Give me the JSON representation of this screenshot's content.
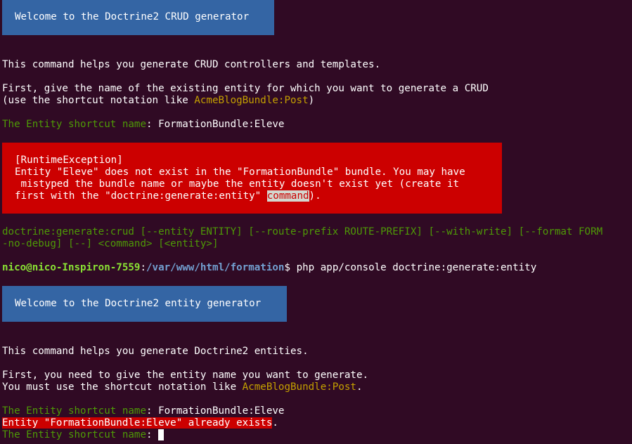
{
  "terminal": {
    "background": "#300a24",
    "colors": {
      "green": "#4e9a06",
      "yellow": "#c4a000",
      "info_box": "#3465a4",
      "error_box": "#cc0000",
      "prompt_user": "#8ae234",
      "prompt_path": "#729fcf"
    },
    "crud_banner": "Welcome to the Doctrine2 CRUD generator",
    "crud_intro": "This command helps you generate CRUD controllers and templates.",
    "crud_first_line1": "First, give the name of the existing entity for which you want to generate a CRUD",
    "crud_first_line2_prefix": "(use the shortcut notation like ",
    "crud_first_line2_example": "AcmeBlogBundle:Post",
    "crud_first_line2_suffix": ")",
    "question_label": "The Entity shortcut name",
    "question_sep": ": ",
    "answer_1": "FormationBundle:Eleve",
    "exception_title": "[RuntimeException]",
    "exception_line1": "Entity \"Eleve\" does not exist in the \"FormationBundle\" bundle. You may have",
    "exception_line2": " mistyped the bundle name or maybe the entity doesn't exist yet (create it",
    "exception_line3_prefix": "first with the \"doctrine:generate:entity\" ",
    "exception_line3_highlight": "command",
    "exception_line3_suffix": ").",
    "usage_line1": "doctrine:generate:crud [--entity ENTITY] [--route-prefix ROUTE-PREFIX] [--with-write] [--format FORM",
    "usage_line2": "-no-debug] [--] <command> [<entity>]",
    "prompt_user_host": "nico@nico-Inspiron-7559",
    "prompt_colon": ":",
    "prompt_path": "/var/www/html/formation",
    "prompt_dollar": "$ ",
    "command": "php app/console doctrine:generate:entity",
    "entity_banner": "Welcome to the Doctrine2 entity generator",
    "entity_intro": "This command helps you generate Doctrine2 entities.",
    "entity_first_line1": "First, you need to give the entity name you want to generate.",
    "entity_first_line2_prefix": "You must use the shortcut notation like ",
    "entity_first_line2_example": "AcmeBlogBundle:Post",
    "entity_first_line2_suffix": ".",
    "answer_2": "FormationBundle:Eleve",
    "entity_exists_error": "Entity \"FormationBundle:Eleve\" already exists",
    "entity_exists_error_suffix": "."
  }
}
